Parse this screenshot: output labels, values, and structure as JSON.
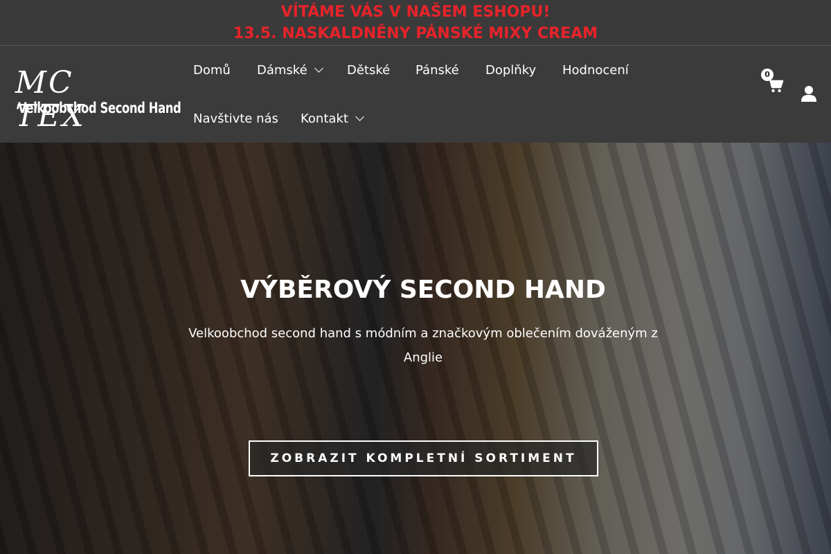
{
  "announcement": {
    "line1": "VÍTÁME VÁS V NAŠEM ESHOPU!",
    "line2": "13.5. NASKALDNĚNY PÁNSKÉ MIXY CREAM",
    "color": "#e8232a"
  },
  "logo": {
    "script": "MC TEX",
    "subtitle": "Velkoobchod Second Hand"
  },
  "nav": {
    "items": [
      {
        "label": "Domů",
        "has_dropdown": false
      },
      {
        "label": "Dámské",
        "has_dropdown": true
      },
      {
        "label": "Dětské",
        "has_dropdown": false
      },
      {
        "label": "Pánské",
        "has_dropdown": false
      },
      {
        "label": "Doplňky",
        "has_dropdown": false
      },
      {
        "label": "Hodnocení",
        "has_dropdown": false
      },
      {
        "label": "Navštivte nás",
        "has_dropdown": false
      },
      {
        "label": "Kontakt",
        "has_dropdown": true
      }
    ]
  },
  "cart": {
    "count": "0",
    "icon": "cart-icon"
  },
  "account": {
    "icon": "user-icon"
  },
  "hero": {
    "title": "VÝBĚROVÝ SECOND HAND",
    "description": "Velkoobchod second hand s módním a značkovým oblečením dováženým z Anglie",
    "cta_label": "ZOBRAZIT KOMPLETNÍ SORTIMENT"
  }
}
